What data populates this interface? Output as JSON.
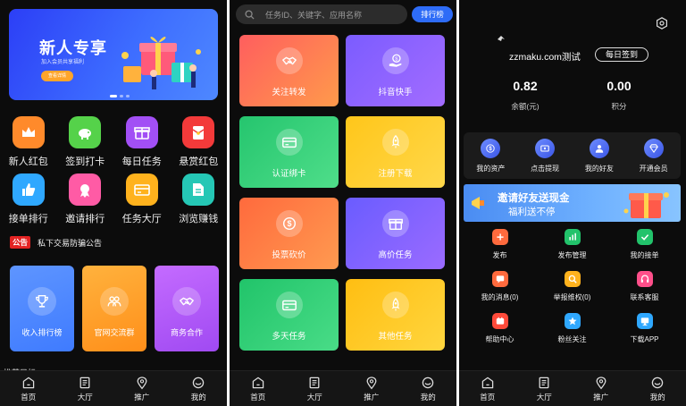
{
  "screen1": {
    "banner": {
      "title": "新人专享",
      "subtitle": "加入会员共享福利",
      "button": "查看详情"
    },
    "icons_row1": [
      {
        "label": "新人红包",
        "icon": "crown-icon",
        "color": "#ff8a2b"
      },
      {
        "label": "签到打卡",
        "icon": "piggy-bank-icon",
        "color": "#55d24a"
      },
      {
        "label": "每日任务",
        "icon": "gift-icon",
        "color": "#a24ff5"
      },
      {
        "label": "悬赏红包",
        "icon": "red-envelope-icon",
        "color": "#f33a3a"
      }
    ],
    "icons_row2": [
      {
        "label": "接单排行",
        "icon": "thumbs-up-icon",
        "color": "#2fa8ff"
      },
      {
        "label": "邀请排行",
        "icon": "medal-icon",
        "color": "#ff5ba5"
      },
      {
        "label": "任务大厅",
        "icon": "card-icon",
        "color": "#ffb21d"
      },
      {
        "label": "浏览赚钱",
        "icon": "document-icon",
        "color": "#25c7b5"
      }
    ],
    "notice": {
      "tag": "公告",
      "text": "私下交易防骗公告"
    },
    "cards": [
      {
        "label": "收入排行榜",
        "icon": "trophy-icon",
        "color1": "#3f7bff",
        "color2": "#5e95ff"
      },
      {
        "label": "官网交流群",
        "icon": "group-icon",
        "color1": "#ff8f1a",
        "color2": "#ffb23d"
      },
      {
        "label": "商务合作",
        "icon": "handshake-icon",
        "color1": "#a04af2",
        "color2": "#c46bff"
      }
    ],
    "truncated_heading": "推荐目标",
    "tabs": [
      "首页",
      "大厅",
      "推广",
      "我的"
    ]
  },
  "screen2": {
    "search_placeholder": "任务ID、关键字、应用名称",
    "rank_button": "排行榜",
    "tiles": [
      {
        "label": "关注转发",
        "icon": "handshake-icon",
        "color1": "#ff5e5e",
        "color2": "#ff9a4b"
      },
      {
        "label": "抖音快手",
        "icon": "money-hand-icon",
        "color1": "#7b5cff",
        "color2": "#a36cff"
      },
      {
        "label": "认证绑卡",
        "icon": "card-icon",
        "color1": "#25c56e",
        "color2": "#4fde8a"
      },
      {
        "label": "注册下载",
        "icon": "rocket-icon",
        "color1": "#ffc61a",
        "color2": "#ffd84a"
      },
      {
        "label": "投票砍价",
        "icon": "dollar-icon",
        "color1": "#ff6a3d",
        "color2": "#ff9a50"
      },
      {
        "label": "高价任务",
        "icon": "gift-icon",
        "color1": "#6a5cff",
        "color2": "#9b6bff"
      },
      {
        "label": "多天任务",
        "icon": "card-icon",
        "color1": "#21c46a",
        "color2": "#49dc87"
      },
      {
        "label": "其他任务",
        "icon": "rocket-icon",
        "color1": "#ffbe12",
        "color2": "#ffd63e"
      }
    ],
    "tabs": [
      "首页",
      "大厅",
      "推广",
      "我的"
    ]
  },
  "screen3": {
    "username": "zzmaku.com测试",
    "sign_button": "每日签到",
    "balance_value": "0.82",
    "balance_label": "余额(元)",
    "points_value": "0.00",
    "points_label": "积分",
    "quick": [
      {
        "label": "我的资产",
        "icon": "dollar-icon"
      },
      {
        "label": "点击提现",
        "icon": "withdraw-icon"
      },
      {
        "label": "我的好友",
        "icon": "user-icon"
      },
      {
        "label": "开通会员",
        "icon": "diamond-icon"
      }
    ],
    "invite_banner": {
      "line1": "邀请好友送现金",
      "line2": "福利送不停"
    },
    "menu": [
      {
        "label": "发布",
        "icon": "plus-icon",
        "color": "#ff6a3d"
      },
      {
        "label": "发布管理",
        "icon": "chart-icon",
        "color": "#22c36b"
      },
      {
        "label": "我的接单",
        "icon": "check-icon",
        "color": "#22c36b"
      },
      {
        "label": "我的消息(0)",
        "icon": "message-icon",
        "color": "#ff6a3d"
      },
      {
        "label": "举报维权(0)",
        "icon": "search-icon",
        "color": "#ffb21d"
      },
      {
        "label": "联系客服",
        "icon": "headset-icon",
        "color": "#ff4f8a"
      },
      {
        "label": "帮助中心",
        "icon": "help-icon",
        "color": "#ff4a3a"
      },
      {
        "label": "粉丝关注",
        "icon": "star-icon",
        "color": "#2fa8ff"
      },
      {
        "label": "下载APP",
        "icon": "download-icon",
        "color": "#2fa8ff"
      }
    ],
    "tabs": [
      "首页",
      "大厅",
      "推广",
      "我的"
    ]
  }
}
